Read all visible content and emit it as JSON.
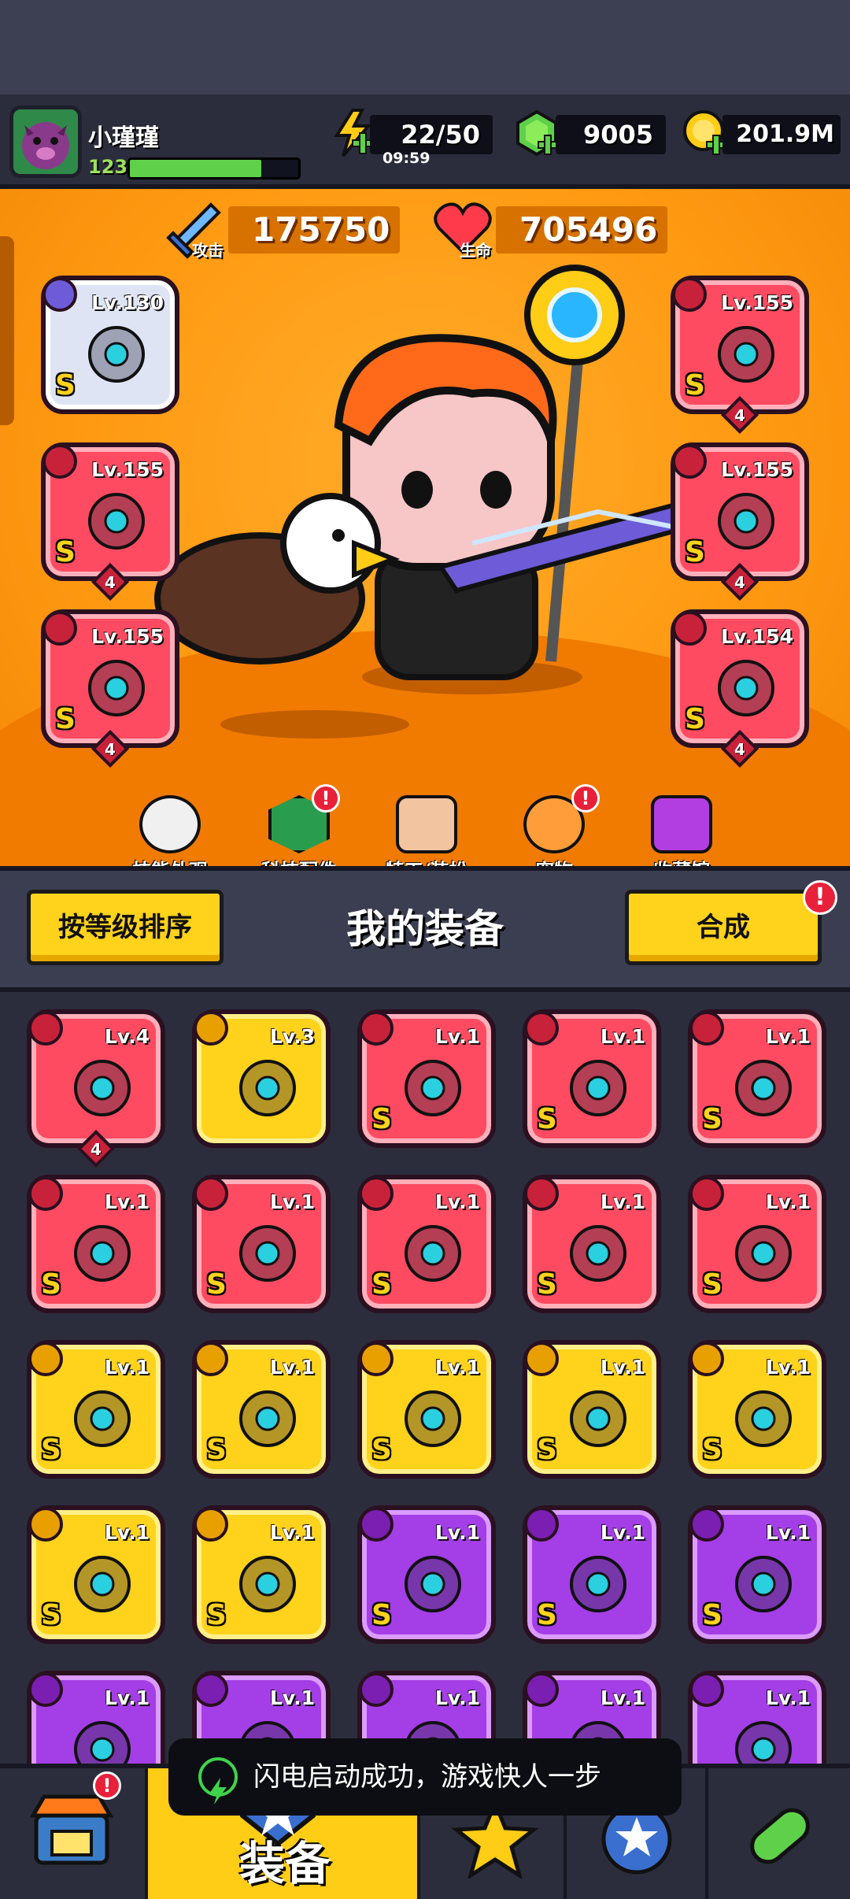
{
  "player": {
    "name": "小瑾瑾",
    "level": "123",
    "xp_fraction": 0.78
  },
  "resources": {
    "energy": "22/50",
    "energy_timer": "09:59",
    "gems": "9005",
    "coins": "201.9M"
  },
  "stats": {
    "attack_label": "攻击",
    "attack": "175750",
    "hp_label": "生命",
    "hp": "705496"
  },
  "equipped": [
    {
      "level": "Lv.130",
      "grade": "S",
      "color": "silver",
      "stars": ""
    },
    {
      "level": "Lv.155",
      "grade": "S",
      "color": "red",
      "stars": "4"
    },
    {
      "level": "Lv.155",
      "grade": "S",
      "color": "red",
      "stars": "4"
    },
    {
      "level": "Lv.155",
      "grade": "S",
      "color": "red",
      "stars": "4"
    },
    {
      "level": "Lv.155",
      "grade": "S",
      "color": "red",
      "stars": "4"
    },
    {
      "level": "Lv.154",
      "grade": "S",
      "color": "red",
      "stars": "4"
    }
  ],
  "menu": [
    {
      "label": "技能外观",
      "icon": "soccer-hat-icon",
      "alert": false
    },
    {
      "label": "科技配件",
      "icon": "tech-hexagon-icon",
      "alert": true
    },
    {
      "label": "特工/装扮",
      "icon": "agent-mask-icon",
      "alert": false
    },
    {
      "label": "宠物",
      "icon": "shiba-dog-icon",
      "alert": true
    },
    {
      "label": "收藏馆",
      "icon": "purple-chest-icon",
      "alert": false
    }
  ],
  "section": {
    "sort_button": "按等级排序",
    "title": "我的装备",
    "merge_button": "合成",
    "merge_alert": "!"
  },
  "inventory": [
    {
      "level": "Lv.4",
      "grade": "",
      "color": "red",
      "stars": "4",
      "icon": "kunai-icon"
    },
    {
      "level": "Lv.3",
      "grade": "",
      "color": "yellow",
      "icon": "gauntlet-icon"
    },
    {
      "level": "Lv.1",
      "grade": "S",
      "color": "red",
      "icon": "star-ring-icon"
    },
    {
      "level": "Lv.1",
      "grade": "S",
      "color": "red",
      "icon": "armor-icon"
    },
    {
      "level": "Lv.1",
      "grade": "S",
      "color": "red",
      "icon": "claw-glove-icon"
    },
    {
      "level": "Lv.1",
      "grade": "S",
      "color": "red",
      "icon": "katana-icon"
    },
    {
      "level": "Lv.1",
      "grade": "S",
      "color": "red",
      "icon": "water-gun-icon"
    },
    {
      "level": "Lv.1",
      "grade": "S",
      "color": "red",
      "icon": "spiked-drill-icon"
    },
    {
      "level": "Lv.1",
      "grade": "S",
      "color": "red",
      "icon": "belt-icon"
    },
    {
      "level": "Lv.1",
      "grade": "S",
      "color": "red",
      "icon": "boot-icon"
    },
    {
      "level": "Lv.1",
      "grade": "S",
      "color": "yellow",
      "icon": "katana-icon"
    },
    {
      "level": "Lv.1",
      "grade": "S",
      "color": "yellow",
      "icon": "water-gun-icon"
    },
    {
      "level": "Lv.1",
      "grade": "S",
      "color": "yellow",
      "icon": "spiked-drill-icon"
    },
    {
      "level": "Lv.1",
      "grade": "S",
      "color": "yellow",
      "icon": "spiked-drill-icon"
    },
    {
      "level": "Lv.1",
      "grade": "S",
      "color": "yellow",
      "icon": "belt-icon"
    },
    {
      "level": "Lv.1",
      "grade": "S",
      "color": "yellow",
      "icon": "dark-belt-icon"
    },
    {
      "level": "Lv.1",
      "grade": "S",
      "color": "yellow",
      "icon": "boot-icon"
    },
    {
      "level": "Lv.1",
      "grade": "S",
      "color": "purple",
      "icon": "spiked-drill-icon"
    },
    {
      "level": "Lv.1",
      "grade": "S",
      "color": "purple",
      "icon": "spiked-drill-icon"
    },
    {
      "level": "Lv.1",
      "grade": "S",
      "color": "purple",
      "icon": "armor-icon"
    },
    {
      "level": "Lv.1",
      "grade": "",
      "color": "purple",
      "icon": "armor-icon"
    },
    {
      "level": "Lv.1",
      "grade": "",
      "color": "purple",
      "icon": "armor-icon"
    },
    {
      "level": "Lv.1",
      "grade": "",
      "color": "purple",
      "icon": "ring-icon"
    },
    {
      "level": "Lv.1",
      "grade": "",
      "color": "purple",
      "icon": "ring-icon"
    },
    {
      "level": "Lv.1",
      "grade": "",
      "color": "purple",
      "icon": "star-ring-icon"
    }
  ],
  "bottom_nav": [
    {
      "label": "",
      "icon": "shop-icon",
      "alert": true
    },
    {
      "label": "装备",
      "icon": "equipment-icon",
      "active": true
    },
    {
      "label": "",
      "icon": "star-icon"
    },
    {
      "label": "",
      "icon": "stars-badge-icon"
    },
    {
      "label": "",
      "icon": "dna-capsule-icon"
    }
  ],
  "toast": {
    "text": "闪电启动成功，游戏快人一步"
  },
  "colors": {
    "accent": "#ffcc16",
    "red_card": "#ff4b61",
    "yellow_card": "#ffd21c",
    "purple_card": "#a43ee6",
    "background": "#2b2d3c"
  }
}
